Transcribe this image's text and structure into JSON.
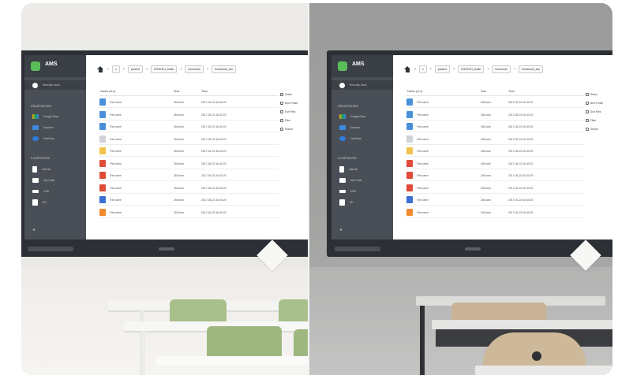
{
  "left_scene": {
    "sidebar": {
      "brand": "AMS",
      "recent": "Recently Used",
      "cloud_title": "Cloud Service",
      "cloud_items": [
        "Google Drive",
        "Dropbox",
        "OneDrive"
      ],
      "local_title": "Local Device",
      "local_items": [
        "Internal",
        "My Folder",
        "USB",
        "SD"
      ]
    },
    "breadcrumb": [
      "present",
      "20190101_folder",
      "homework",
      "homework_ass"
    ],
    "table_headers": [
      "Name (A-z)",
      "Size",
      "Time"
    ],
    "rows": [
      {
        "name": "File name",
        "size": "266 kom",
        "time": "2017-06-23  16:40:20",
        "color": "#4a90d9"
      },
      {
        "name": "File name",
        "size": "266 kom",
        "time": "2017-06-23  16:40:20",
        "color": "#4a90d9"
      },
      {
        "name": "File name",
        "size": "266 kom",
        "time": "2017-06-23  16:40:20",
        "color": "#4a90d9"
      },
      {
        "name": "File name",
        "size": "266 kom",
        "time": "2017-06-23  16:40:20",
        "color": "#cfd3d8"
      },
      {
        "name": "File name",
        "size": "266 kom",
        "time": "2017-06-23  16:40:20",
        "color": "#f2c14a"
      },
      {
        "name": "File name",
        "size": "266 kom",
        "time": "2017-06-23  16:40:20",
        "color": "#e04b3a"
      },
      {
        "name": "File name",
        "size": "266 kom",
        "time": "2017-06-23  16:40:20",
        "color": "#e04b3a"
      },
      {
        "name": "File name",
        "size": "266 kom",
        "time": "2017-06-23  16:40:20",
        "color": "#e04b3a"
      },
      {
        "name": "File name",
        "size": "266 kom",
        "time": "2017-06-23  16:40:20",
        "color": "#3b6fd1"
      },
      {
        "name": "File name",
        "size": "266 kom",
        "time": "2017-06-23  16:40:20",
        "color": "#f08a2c"
      }
    ],
    "actions": [
      "Select",
      "New Folder",
      "Sort Files",
      "Filter",
      "Search"
    ]
  },
  "right_scene": {
    "sidebar": {
      "brand": "AMS",
      "recent": "Recently Used",
      "cloud_title": "Cloud Service",
      "cloud_items": [
        "Google Drive",
        "Dropbox",
        "OneDrive"
      ],
      "local_title": "Local Device",
      "local_items": [
        "Internal",
        "My Folder",
        "USB",
        "SD"
      ]
    },
    "breadcrumb": [
      "present",
      "20190101_folder",
      "homework",
      "homework_ass"
    ],
    "table_headers": [
      "Name (A-z)",
      "Size",
      "Time"
    ],
    "rows": [
      {
        "name": "File name",
        "size": "266 kom",
        "time": "2017-06-23  16:40:20"
      },
      {
        "name": "File name",
        "size": "266 kom",
        "time": "2017-06-23  16:40:20"
      },
      {
        "name": "File name",
        "size": "266 kom",
        "time": "2017-06-23  16:40:20"
      },
      {
        "name": "File name",
        "size": "266 kom",
        "time": "2017-06-23  16:40:20"
      },
      {
        "name": "File name",
        "size": "266 kom",
        "time": "2017-06-23  16:40:20"
      },
      {
        "name": "File name",
        "size": "266 kom",
        "time": "2017-06-23  16:40:20"
      },
      {
        "name": "File name",
        "size": "266 kom",
        "time": "2017-06-23  16:40:20"
      },
      {
        "name": "File name",
        "size": "266 kom",
        "time": "2017-06-23  16:40:20"
      },
      {
        "name": "File name",
        "size": "266 kom",
        "time": "2017-06-23  16:40:20"
      },
      {
        "name": "File name",
        "size": "266 kom",
        "time": "2017-06-23  16:40:20"
      }
    ],
    "actions": [
      "Select",
      "New Folder",
      "Sort Files",
      "Filter",
      "Search"
    ]
  },
  "colors": {
    "sidebar_bg": "#4a4f57",
    "brand_green": "#5bbd59",
    "bright_chair": "#a9bf8c",
    "grey_chair": "#c8b396"
  }
}
